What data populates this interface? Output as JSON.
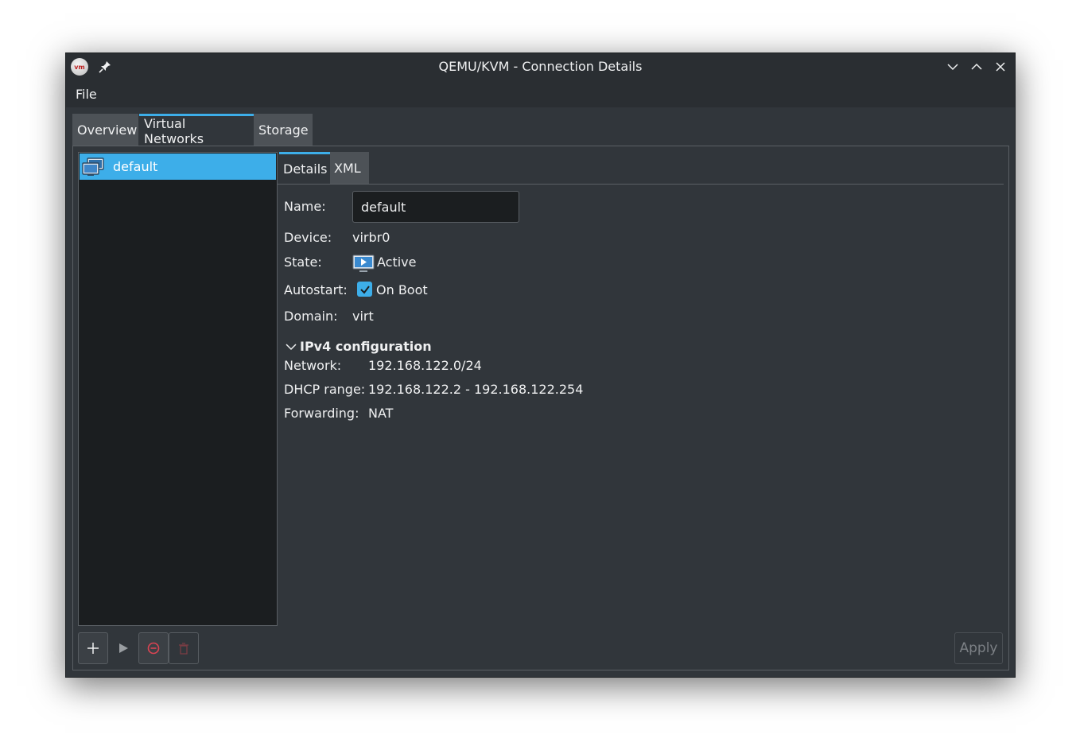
{
  "window": {
    "title": "QEMU/KVM - Connection Details",
    "app_icon_text": "vm"
  },
  "menubar": {
    "file": "File"
  },
  "tabs": [
    {
      "label": "Overview",
      "active": false
    },
    {
      "label": "Virtual Networks",
      "active": true
    },
    {
      "label": "Storage",
      "active": false
    }
  ],
  "networks": [
    {
      "name": "default",
      "selected": true
    }
  ],
  "detail_tabs": [
    {
      "label": "Details",
      "active": true
    },
    {
      "label": "XML",
      "active": false
    }
  ],
  "details": {
    "name_label": "Name:",
    "name_value": "default",
    "device_label": "Device:",
    "device_value": "virbr0",
    "state_label": "State:",
    "state_value": "Active",
    "autostart_label": "Autostart:",
    "autostart_value": "On Boot",
    "autostart_checked": true,
    "domain_label": "Domain:",
    "domain_value": "virt"
  },
  "ipv4": {
    "title": "IPv4 configuration",
    "network_label": "Network:",
    "network_value": "192.168.122.0/24",
    "dhcp_label": "DHCP range:",
    "dhcp_value": "192.168.122.2 - 192.168.122.254",
    "forwarding_label": "Forwarding:",
    "forwarding_value": "NAT"
  },
  "buttons": {
    "apply": "Apply"
  },
  "colors": {
    "accent": "#3daee9",
    "window_bg": "#31363b",
    "list_bg": "#1b1e20",
    "stop_red": "#da4453"
  }
}
